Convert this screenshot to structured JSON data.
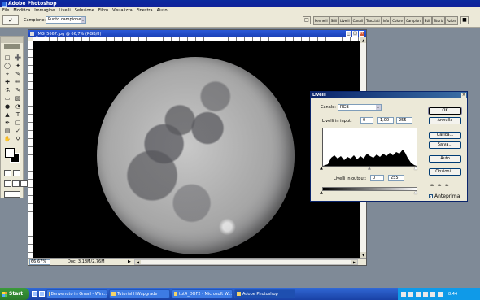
{
  "app": {
    "title": "Adobe Photoshop",
    "menu": [
      "File",
      "Modifica",
      "Immagine",
      "Livelli",
      "Selezione",
      "Filtro",
      "Visualizza",
      "Finestra",
      "Aiuto"
    ]
  },
  "options_bar": {
    "sample_label": "Campione:",
    "sample_value": "Punto campione",
    "palette_tabs": [
      "Pennelli",
      "Stili",
      "Livelli",
      "Canali",
      "Tracciati",
      "Info",
      "Colore",
      "Campioni",
      "Stili",
      "Storia",
      "Azioni"
    ]
  },
  "document": {
    "title": "_MG_5667.jpg @ 66,7% (RGB/8)",
    "zoom": "66,67%",
    "info": "Doc: 3,18M/2,76M"
  },
  "levels_dialog": {
    "title": "Livelli",
    "channel_label": "Canale:",
    "channel_value": "RGB",
    "input_label": "Livelli in input:",
    "input_black": "0",
    "input_gamma": "1,00",
    "input_white": "255",
    "output_label": "Livelli in output:",
    "output_black": "0",
    "output_white": "255",
    "buttons": {
      "ok": "OK",
      "cancel": "Annulla",
      "load": "Carica...",
      "save": "Salva...",
      "auto": "Auto",
      "options": "Opzioni..."
    },
    "preview_label": "Anteprima",
    "preview_checked": true
  },
  "taskbar": {
    "start": "Start",
    "items": [
      "Benvenuto in Gmail - Win...",
      "Tutorial HWupgrade",
      "tut4_DOF2 - Microsoft W...",
      "Adobe Photoshop"
    ],
    "clock": "8.44"
  }
}
